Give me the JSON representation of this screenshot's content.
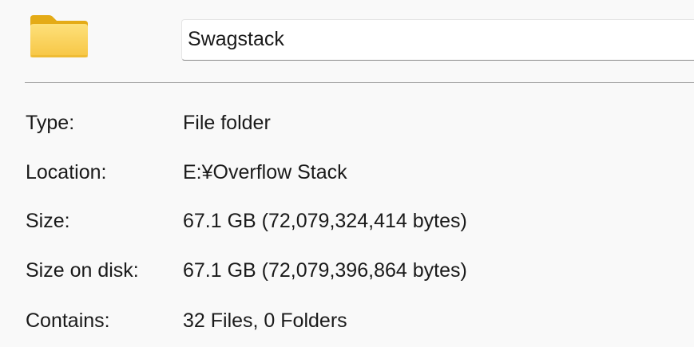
{
  "folder": {
    "icon": "folder-icon",
    "name": "Swagstack"
  },
  "properties": [
    {
      "label": "Type:",
      "value": "File folder"
    },
    {
      "label": "Location:",
      "value": "E:¥Overflow Stack"
    },
    {
      "label": "Size:",
      "value": "67.1 GB (72,079,324,414 bytes)"
    },
    {
      "label": "Size on disk:",
      "value": "67.1 GB (72,079,396,864 bytes)"
    },
    {
      "label": "Contains:",
      "value": "32 Files, 0 Folders"
    }
  ],
  "colors": {
    "folder_back": "#e8b21e",
    "folder_front": "#fcd461",
    "background": "#f9f9f9"
  }
}
